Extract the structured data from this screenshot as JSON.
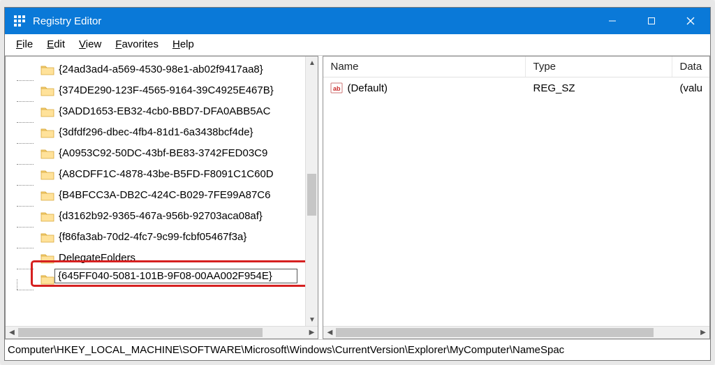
{
  "window": {
    "title": "Registry Editor"
  },
  "menu": {
    "file": "File",
    "edit": "Edit",
    "view": "View",
    "favorites": "Favorites",
    "help": "Help"
  },
  "tree_items": [
    "{24ad3ad4-a569-4530-98e1-ab02f9417aa8}",
    "{374DE290-123F-4565-9164-39C4925E467B}",
    "{3ADD1653-EB32-4cb0-BBD7-DFA0ABB5AC",
    "{3dfdf296-dbec-4fb4-81d1-6a3438bcf4de}",
    "{A0953C92-50DC-43bf-BE83-3742FED03C9",
    "{A8CDFF1C-4878-43be-B5FD-F8091C1C60D",
    "{B4BFCC3A-DB2C-424C-B029-7FE99A87C6",
    "{d3162b92-9365-467a-956b-92703aca08af}",
    "{f86fa3ab-70d2-4fc7-9c99-fcbf05467f3a}",
    "DelegateFolders"
  ],
  "editing_value": "{645FF040-5081-101B-9F08-00AA002F954E}",
  "list": {
    "columns": {
      "name": "Name",
      "type": "Type",
      "data": "Data"
    },
    "rows": [
      {
        "name": "(Default)",
        "type": "REG_SZ",
        "data": "(valu"
      }
    ]
  },
  "status_path": "Computer\\HKEY_LOCAL_MACHINE\\SOFTWARE\\Microsoft\\Windows\\CurrentVersion\\Explorer\\MyComputer\\NameSpac"
}
